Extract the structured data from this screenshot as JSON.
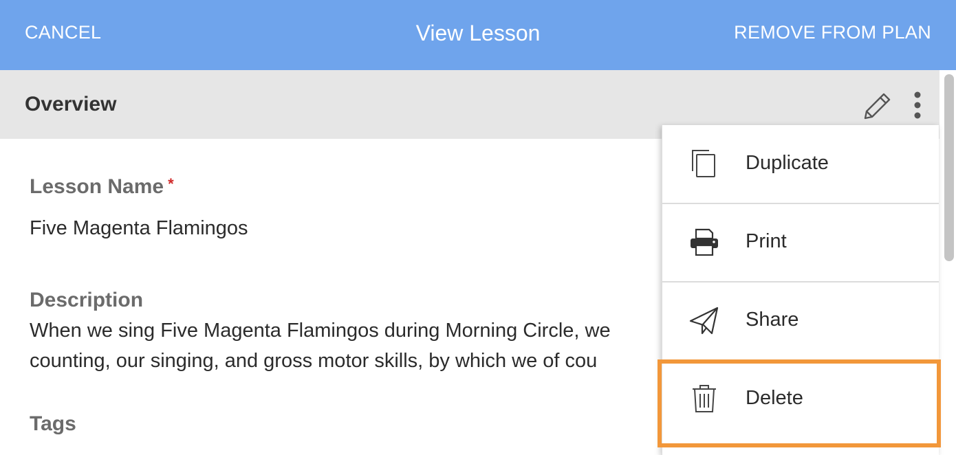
{
  "header": {
    "cancel_label": "CANCEL",
    "title": "View Lesson",
    "remove_label": "REMOVE FROM PLAN"
  },
  "section": {
    "title": "Overview",
    "edit_icon": "pencil-icon",
    "more_icon": "kebab-menu-icon"
  },
  "fields": {
    "lesson_name": {
      "label": "Lesson Name",
      "required_mark": "*",
      "value": "Five Magenta Flamingos"
    },
    "description": {
      "label": "Description",
      "line1": "When we sing Five Magenta Flamingos during Morning Circle, we",
      "line2": "counting, our singing, and gross motor skills, by which we of cou"
    },
    "tags": {
      "label": "Tags"
    }
  },
  "menu": {
    "items": [
      {
        "label": "Duplicate",
        "icon": "duplicate-icon"
      },
      {
        "label": "Print",
        "icon": "printer-icon"
      },
      {
        "label": "Share",
        "icon": "paper-plane-icon"
      },
      {
        "label": "Delete",
        "icon": "trash-icon"
      }
    ],
    "highlight_color": "#f2973a"
  },
  "colors": {
    "header_bg": "#6fa4ec",
    "section_bg": "#e6e6e6",
    "required": "#d02a2a"
  }
}
